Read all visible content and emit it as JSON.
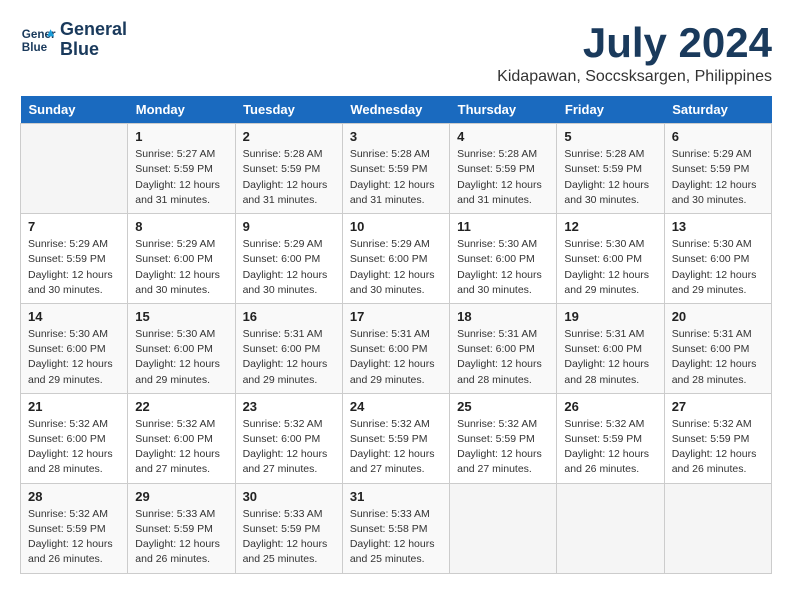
{
  "logo": {
    "line1": "General",
    "line2": "Blue"
  },
  "title": "July 2024",
  "subtitle": "Kidapawan, Soccsksargen, Philippines",
  "calendar": {
    "headers": [
      "Sunday",
      "Monday",
      "Tuesday",
      "Wednesday",
      "Thursday",
      "Friday",
      "Saturday"
    ],
    "weeks": [
      [
        {
          "day": "",
          "info": ""
        },
        {
          "day": "1",
          "info": "Sunrise: 5:27 AM\nSunset: 5:59 PM\nDaylight: 12 hours\nand 31 minutes."
        },
        {
          "day": "2",
          "info": "Sunrise: 5:28 AM\nSunset: 5:59 PM\nDaylight: 12 hours\nand 31 minutes."
        },
        {
          "day": "3",
          "info": "Sunrise: 5:28 AM\nSunset: 5:59 PM\nDaylight: 12 hours\nand 31 minutes."
        },
        {
          "day": "4",
          "info": "Sunrise: 5:28 AM\nSunset: 5:59 PM\nDaylight: 12 hours\nand 31 minutes."
        },
        {
          "day": "5",
          "info": "Sunrise: 5:28 AM\nSunset: 5:59 PM\nDaylight: 12 hours\nand 30 minutes."
        },
        {
          "day": "6",
          "info": "Sunrise: 5:29 AM\nSunset: 5:59 PM\nDaylight: 12 hours\nand 30 minutes."
        }
      ],
      [
        {
          "day": "7",
          "info": "Sunrise: 5:29 AM\nSunset: 5:59 PM\nDaylight: 12 hours\nand 30 minutes."
        },
        {
          "day": "8",
          "info": "Sunrise: 5:29 AM\nSunset: 6:00 PM\nDaylight: 12 hours\nand 30 minutes."
        },
        {
          "day": "9",
          "info": "Sunrise: 5:29 AM\nSunset: 6:00 PM\nDaylight: 12 hours\nand 30 minutes."
        },
        {
          "day": "10",
          "info": "Sunrise: 5:29 AM\nSunset: 6:00 PM\nDaylight: 12 hours\nand 30 minutes."
        },
        {
          "day": "11",
          "info": "Sunrise: 5:30 AM\nSunset: 6:00 PM\nDaylight: 12 hours\nand 30 minutes."
        },
        {
          "day": "12",
          "info": "Sunrise: 5:30 AM\nSunset: 6:00 PM\nDaylight: 12 hours\nand 29 minutes."
        },
        {
          "day": "13",
          "info": "Sunrise: 5:30 AM\nSunset: 6:00 PM\nDaylight: 12 hours\nand 29 minutes."
        }
      ],
      [
        {
          "day": "14",
          "info": "Sunrise: 5:30 AM\nSunset: 6:00 PM\nDaylight: 12 hours\nand 29 minutes."
        },
        {
          "day": "15",
          "info": "Sunrise: 5:30 AM\nSunset: 6:00 PM\nDaylight: 12 hours\nand 29 minutes."
        },
        {
          "day": "16",
          "info": "Sunrise: 5:31 AM\nSunset: 6:00 PM\nDaylight: 12 hours\nand 29 minutes."
        },
        {
          "day": "17",
          "info": "Sunrise: 5:31 AM\nSunset: 6:00 PM\nDaylight: 12 hours\nand 29 minutes."
        },
        {
          "day": "18",
          "info": "Sunrise: 5:31 AM\nSunset: 6:00 PM\nDaylight: 12 hours\nand 28 minutes."
        },
        {
          "day": "19",
          "info": "Sunrise: 5:31 AM\nSunset: 6:00 PM\nDaylight: 12 hours\nand 28 minutes."
        },
        {
          "day": "20",
          "info": "Sunrise: 5:31 AM\nSunset: 6:00 PM\nDaylight: 12 hours\nand 28 minutes."
        }
      ],
      [
        {
          "day": "21",
          "info": "Sunrise: 5:32 AM\nSunset: 6:00 PM\nDaylight: 12 hours\nand 28 minutes."
        },
        {
          "day": "22",
          "info": "Sunrise: 5:32 AM\nSunset: 6:00 PM\nDaylight: 12 hours\nand 27 minutes."
        },
        {
          "day": "23",
          "info": "Sunrise: 5:32 AM\nSunset: 6:00 PM\nDaylight: 12 hours\nand 27 minutes."
        },
        {
          "day": "24",
          "info": "Sunrise: 5:32 AM\nSunset: 5:59 PM\nDaylight: 12 hours\nand 27 minutes."
        },
        {
          "day": "25",
          "info": "Sunrise: 5:32 AM\nSunset: 5:59 PM\nDaylight: 12 hours\nand 27 minutes."
        },
        {
          "day": "26",
          "info": "Sunrise: 5:32 AM\nSunset: 5:59 PM\nDaylight: 12 hours\nand 26 minutes."
        },
        {
          "day": "27",
          "info": "Sunrise: 5:32 AM\nSunset: 5:59 PM\nDaylight: 12 hours\nand 26 minutes."
        }
      ],
      [
        {
          "day": "28",
          "info": "Sunrise: 5:32 AM\nSunset: 5:59 PM\nDaylight: 12 hours\nand 26 minutes."
        },
        {
          "day": "29",
          "info": "Sunrise: 5:33 AM\nSunset: 5:59 PM\nDaylight: 12 hours\nand 26 minutes."
        },
        {
          "day": "30",
          "info": "Sunrise: 5:33 AM\nSunset: 5:59 PM\nDaylight: 12 hours\nand 25 minutes."
        },
        {
          "day": "31",
          "info": "Sunrise: 5:33 AM\nSunset: 5:58 PM\nDaylight: 12 hours\nand 25 minutes."
        },
        {
          "day": "",
          "info": ""
        },
        {
          "day": "",
          "info": ""
        },
        {
          "day": "",
          "info": ""
        }
      ]
    ]
  }
}
